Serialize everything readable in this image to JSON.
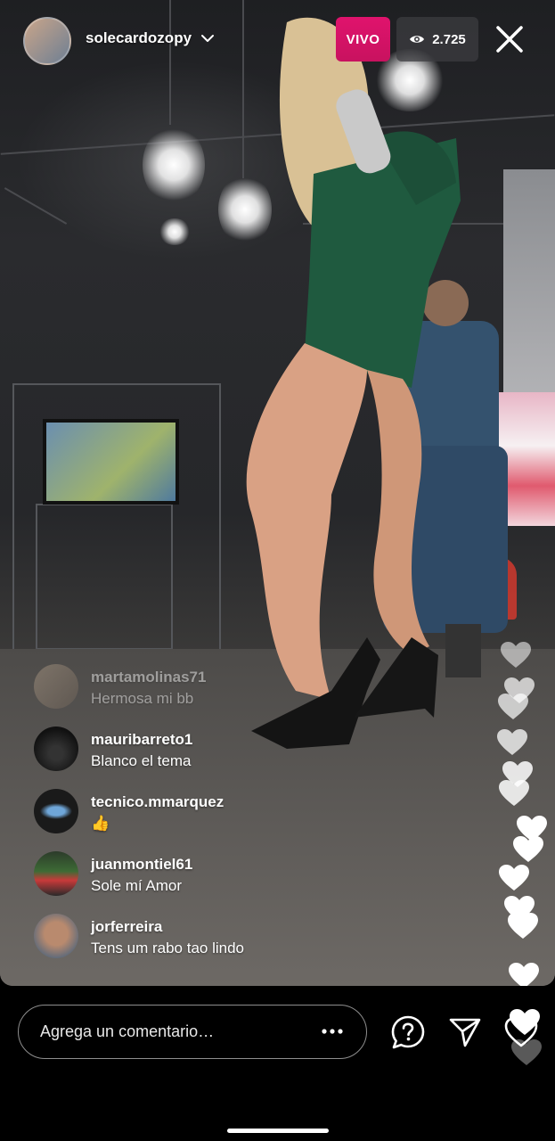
{
  "header": {
    "username": "solecardozopy",
    "live_label": "VIVO",
    "viewer_count": "2.725"
  },
  "comments": [
    {
      "user": "martamolinas71",
      "text": "Hermosa mi bb",
      "faded": true
    },
    {
      "user": "mauribarreto1",
      "text": "Blanco el tema",
      "faded": false
    },
    {
      "user": "tecnico.mmarquez",
      "text": "👍",
      "faded": false
    },
    {
      "user": "juanmontiel61",
      "text": "Sole mí Amor",
      "faded": false
    },
    {
      "user": "jorferreira",
      "text": "Tens um rabo tao lindo",
      "faded": false
    }
  ],
  "composer": {
    "placeholder": "Agrega un comentario…"
  },
  "colors": {
    "live_badge": "#d8126a",
    "viewer_badge": "#3c3c40",
    "background": "#000000"
  },
  "icons": [
    "chevron-down-icon",
    "eye-icon",
    "close-icon",
    "more-icon",
    "question-icon",
    "send-icon",
    "heart-icon"
  ]
}
